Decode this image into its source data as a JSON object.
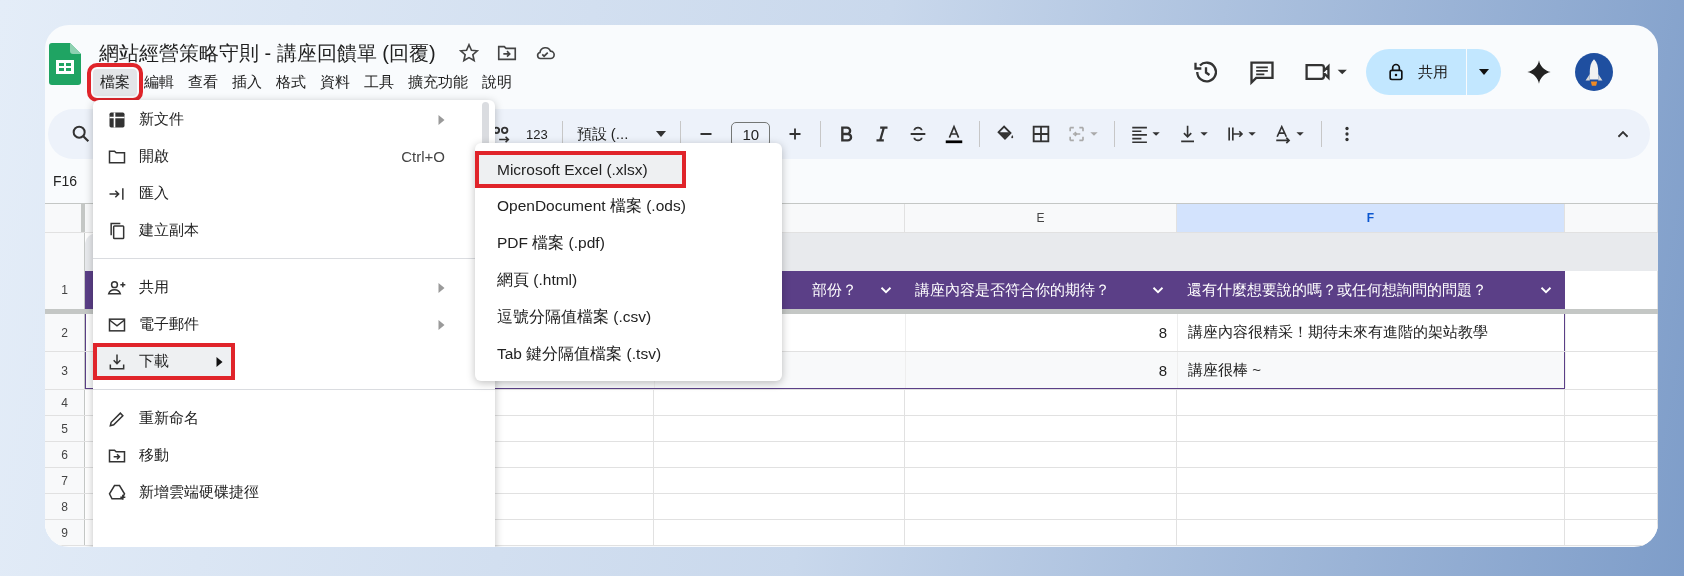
{
  "document": {
    "title": "網站經營策略守則 - 講座回饋單 (回覆)"
  },
  "menu_bar": [
    {
      "label": "檔案",
      "selected": true,
      "annotated": true
    },
    {
      "label": "編輯",
      "selected": false,
      "annotated": false
    },
    {
      "label": "查看",
      "selected": false,
      "annotated": false
    },
    {
      "label": "插入",
      "selected": false,
      "annotated": false
    },
    {
      "label": "格式",
      "selected": false,
      "annotated": false
    },
    {
      "label": "資料",
      "selected": false,
      "annotated": false
    },
    {
      "label": "工具",
      "selected": false,
      "annotated": false
    },
    {
      "label": "擴充功能",
      "selected": false,
      "annotated": false
    },
    {
      "label": "說明",
      "selected": false,
      "annotated": false
    }
  ],
  "share_button": {
    "label": "共用"
  },
  "toolbar": {
    "number_format": "123",
    "font": "預設 (...",
    "font_size": "10"
  },
  "name_box": {
    "value": "F16"
  },
  "column_headers": [
    {
      "label": "E",
      "selected": false
    },
    {
      "label": "F",
      "selected": true
    }
  ],
  "rows": [
    {
      "number": "1",
      "kind": "header",
      "column_d": "部份？",
      "column_e": "講座內容是否符合你的期待？",
      "column_f": "還有什麼想要說的嗎？或任何想詢問的問題？"
    },
    {
      "number": "2",
      "kind": "data",
      "column_e": "8",
      "column_f": "講座內容很精采！期待未來有進階的架站教學"
    },
    {
      "number": "3",
      "kind": "data",
      "column_e": "8",
      "column_f": "講座很棒 ~"
    },
    {
      "number": "4",
      "kind": "empty"
    },
    {
      "number": "5",
      "kind": "empty"
    },
    {
      "number": "6",
      "kind": "empty"
    },
    {
      "number": "7",
      "kind": "empty"
    },
    {
      "number": "8",
      "kind": "empty"
    },
    {
      "number": "9",
      "kind": "empty"
    }
  ],
  "file_menu": {
    "items": [
      {
        "kind": "item",
        "label": "新文件",
        "submenu": true,
        "selected": false,
        "annotated": false
      },
      {
        "kind": "item",
        "label": "開啟",
        "shortcut": "Ctrl+O",
        "submenu": false,
        "selected": false,
        "annotated": false
      },
      {
        "kind": "item",
        "label": "匯入",
        "submenu": false,
        "selected": false,
        "annotated": false
      },
      {
        "kind": "item",
        "label": "建立副本",
        "submenu": false,
        "selected": false,
        "annotated": false
      },
      {
        "kind": "divider"
      },
      {
        "kind": "item",
        "label": "共用",
        "submenu": true,
        "selected": false,
        "annotated": false
      },
      {
        "kind": "item",
        "label": "電子郵件",
        "submenu": true,
        "selected": false,
        "annotated": false
      },
      {
        "kind": "item",
        "label": "下載",
        "submenu": true,
        "selected": true,
        "annotated": true
      },
      {
        "kind": "divider"
      },
      {
        "kind": "item",
        "label": "重新命名",
        "submenu": false,
        "selected": false,
        "annotated": false
      },
      {
        "kind": "item",
        "label": "移動",
        "submenu": false,
        "selected": false,
        "annotated": false
      },
      {
        "kind": "item",
        "label": "新增雲端硬碟捷徑",
        "submenu": false,
        "selected": false,
        "annotated": false
      }
    ]
  },
  "download_submenu": {
    "items": [
      {
        "label": "Microsoft Excel (.xlsx)",
        "selected": true,
        "annotated": true
      },
      {
        "label": "OpenDocument 檔案 (.ods)",
        "selected": false,
        "annotated": false
      },
      {
        "label": "PDF 檔案 (.pdf)",
        "selected": false,
        "annotated": false
      },
      {
        "label": "網頁 (.html)",
        "selected": false,
        "annotated": false
      },
      {
        "label": "逗號分隔值檔案 (.csv)",
        "selected": false,
        "annotated": false
      },
      {
        "label": "Tab 鍵分隔值檔案 (.tsv)",
        "selected": false,
        "annotated": false
      }
    ]
  }
}
